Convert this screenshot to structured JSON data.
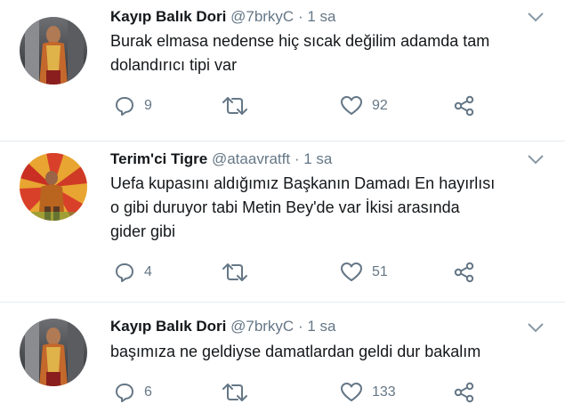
{
  "colors": {
    "icon": "#657786",
    "name": "#14171a",
    "meta": "#657786",
    "divider": "#e6ecf0"
  },
  "tweets": [
    {
      "name": "Kayıp Balık Dori",
      "handle": "@7brkyC",
      "separator": "·",
      "time": "1 sa",
      "lines": [
        "Burak elmasa nedense hiç sıcak değilim adamda tam",
        "dolandırıcı tipi var"
      ],
      "replies": "9",
      "retweets": "",
      "likes": "92"
    },
    {
      "name": "Terim'ci Tigre",
      "handle": "@ataavratft",
      "separator": "·",
      "time": "1 sa",
      "lines": [
        "Uefa kupasını aldığımız Başkanın Damadı En hayırlısı",
        "o gibi duruyor tabi Metin Bey'de var İkisi arasında",
        "gider gibi"
      ],
      "replies": "4",
      "retweets": "",
      "likes": "51"
    },
    {
      "name": "Kayıp Balık Dori",
      "handle": "@7brkyC",
      "separator": "·",
      "time": "1 sa",
      "lines": [
        "başımıza ne geldiyse damatlardan geldi dur bakalım"
      ],
      "replies": "6",
      "retweets": "",
      "likes": "133"
    }
  ],
  "icons": {
    "avatar": "avatar",
    "reply": "reply-icon",
    "retweet": "retweet-icon",
    "like": "heart-icon",
    "share": "share-icon",
    "menu": "chevron-down-icon"
  }
}
